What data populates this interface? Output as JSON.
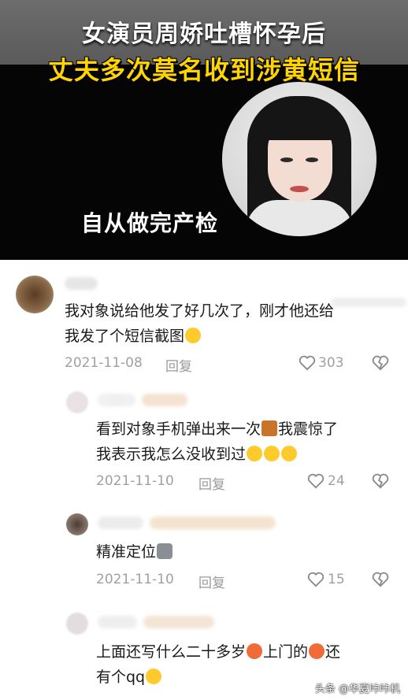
{
  "headline": {
    "line1": "女演员周娇吐槽怀孕后",
    "line2": "丈夫多次莫名收到涉黄短信"
  },
  "video": {
    "caption": "自从做完产检"
  },
  "colors": {
    "headline_yellow": "#ffd400",
    "meta_gray": "#a0a0a0"
  },
  "comments": [
    {
      "text_line1": "我对象说给他发了好几次了，刚才他还给",
      "text_line2": "我发了个短信截图",
      "emoji": "laughing-tears-emoji",
      "date": "2021-11-08",
      "reply": "回复",
      "likes": "303"
    },
    {
      "text_line1": "看到对象手机弹出来一次",
      "text_line1b": "我震惊了",
      "text_line2": "我表示我怎么没收到过",
      "date": "2021-11-10",
      "reply": "回复",
      "likes": "24"
    },
    {
      "text_line1": "精准定位",
      "date": "2021-11-10",
      "reply": "回复",
      "likes": "15"
    },
    {
      "text_line1": "上面还写什么二十多岁",
      "text_line1b": "上门的",
      "text_line1c": "还",
      "text_line2": "有个qq"
    }
  ],
  "watermark": "头条 @华夏咔咔机"
}
